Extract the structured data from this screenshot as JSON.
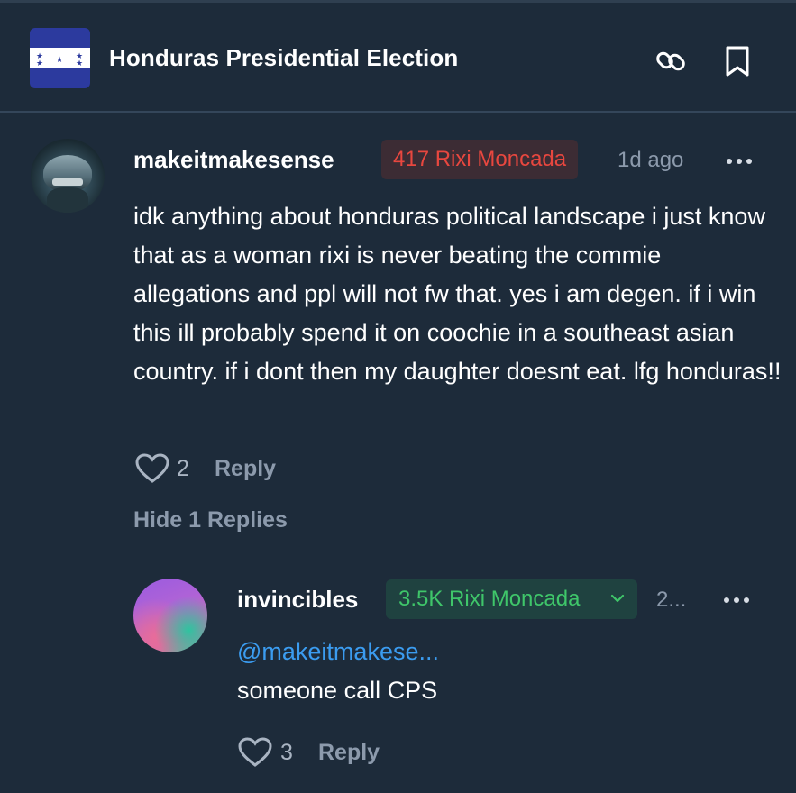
{
  "header": {
    "title": "Honduras Presidential Election",
    "flag_icon": "honduras-flag",
    "link_icon": "link-icon",
    "bookmark_icon": "bookmark-icon"
  },
  "comment": {
    "username": "makeitmakesense",
    "position_badge": "417 Rixi Moncada",
    "time": "1d ago",
    "text": "idk anything about honduras political landscape i just know that as a woman rixi is never beating the commie allegations and ppl will not fw that. yes i am degen. if i win this ill probably spend it on coochie in a southeast asian country. if i dont then my daughter doesnt eat. lfg honduras!!",
    "likes": "2",
    "reply_label": "Reply",
    "hide_replies_label": "Hide 1 Replies"
  },
  "reply": {
    "username": "invincibles",
    "position_badge": "3.5K Rixi Moncada",
    "time": "2...",
    "mention": "@makeitmakese...",
    "text": "someone call CPS",
    "likes": "3",
    "reply_label": "Reply"
  },
  "colors": {
    "background": "#1d2b3a",
    "red_badge_text": "#e8473f",
    "green_badge_text": "#3fc66a",
    "mention": "#3b9cf0",
    "muted": "#8c9aac"
  }
}
